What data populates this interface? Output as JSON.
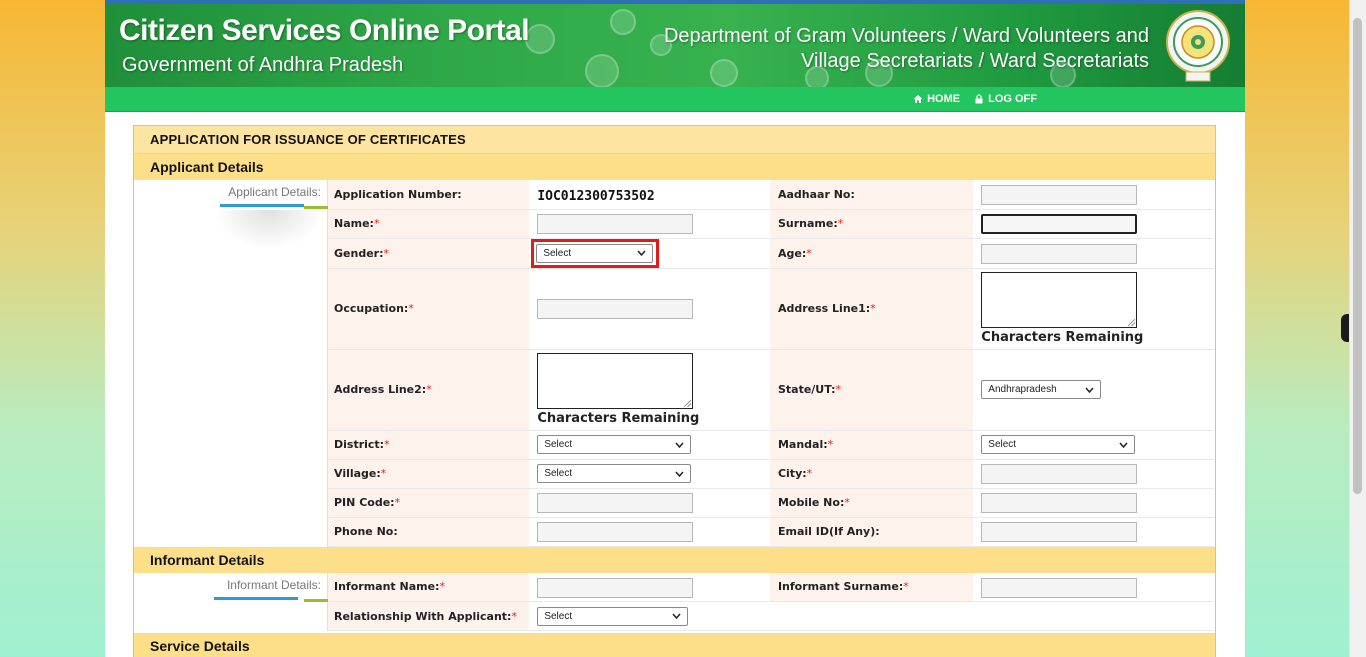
{
  "banner": {
    "title": "Citizen Services Online Portal",
    "subtitle": "Government of Andhra Pradesh",
    "dept_line1": "Department of Gram Volunteers / Ward Volunteers and",
    "dept_line2": "Village Secretariats / Ward Secretariats"
  },
  "nav": {
    "home": "HOME",
    "logoff": "LOG OFF"
  },
  "form": {
    "title": "APPLICATION FOR ISSUANCE OF CERTIFICATES",
    "applicant_section": "Applicant Details",
    "applicant_side_label": "Applicant Details:",
    "application_number_label": "Application Number:",
    "application_number": "IOC012300753502",
    "aadhaar_label": "Aadhaar No:",
    "name_label": "Name:",
    "surname_label": "Surname:",
    "gender_label": "Gender:",
    "gender_value": "Select",
    "age_label": "Age:",
    "occupation_label": "Occupation:",
    "address1_label": "Address Line1:",
    "address2_label": "Address Line2:",
    "chars_remaining": "Characters Remaining",
    "state_label": "State/UT:",
    "state_value": "Andhrapradesh",
    "district_label": "District:",
    "district_value": "Select",
    "mandal_label": "Mandal:",
    "mandal_value": "Select",
    "village_label": "Village:",
    "village_value": "Select",
    "city_label": "City:",
    "pin_label": "PIN Code:",
    "mobile_label": "Mobile No:",
    "phone_label": "Phone No:",
    "email_label": "Email ID(If Any):",
    "required_mark": "*",
    "informant_section": "Informant Details",
    "informant_side_label": "Informant Details:",
    "informant_name_label": "Informant Name:",
    "informant_surname_label": "Informant Surname:",
    "relationship_label": "Relationship With Applicant:",
    "relationship_value": "Select",
    "service_section": "Service Details"
  },
  "colors": {
    "section_header": "#fddf8a",
    "label_bg": "#fef3ec",
    "nav_green": "#22c55e",
    "highlight_red": "#e31b1b"
  }
}
